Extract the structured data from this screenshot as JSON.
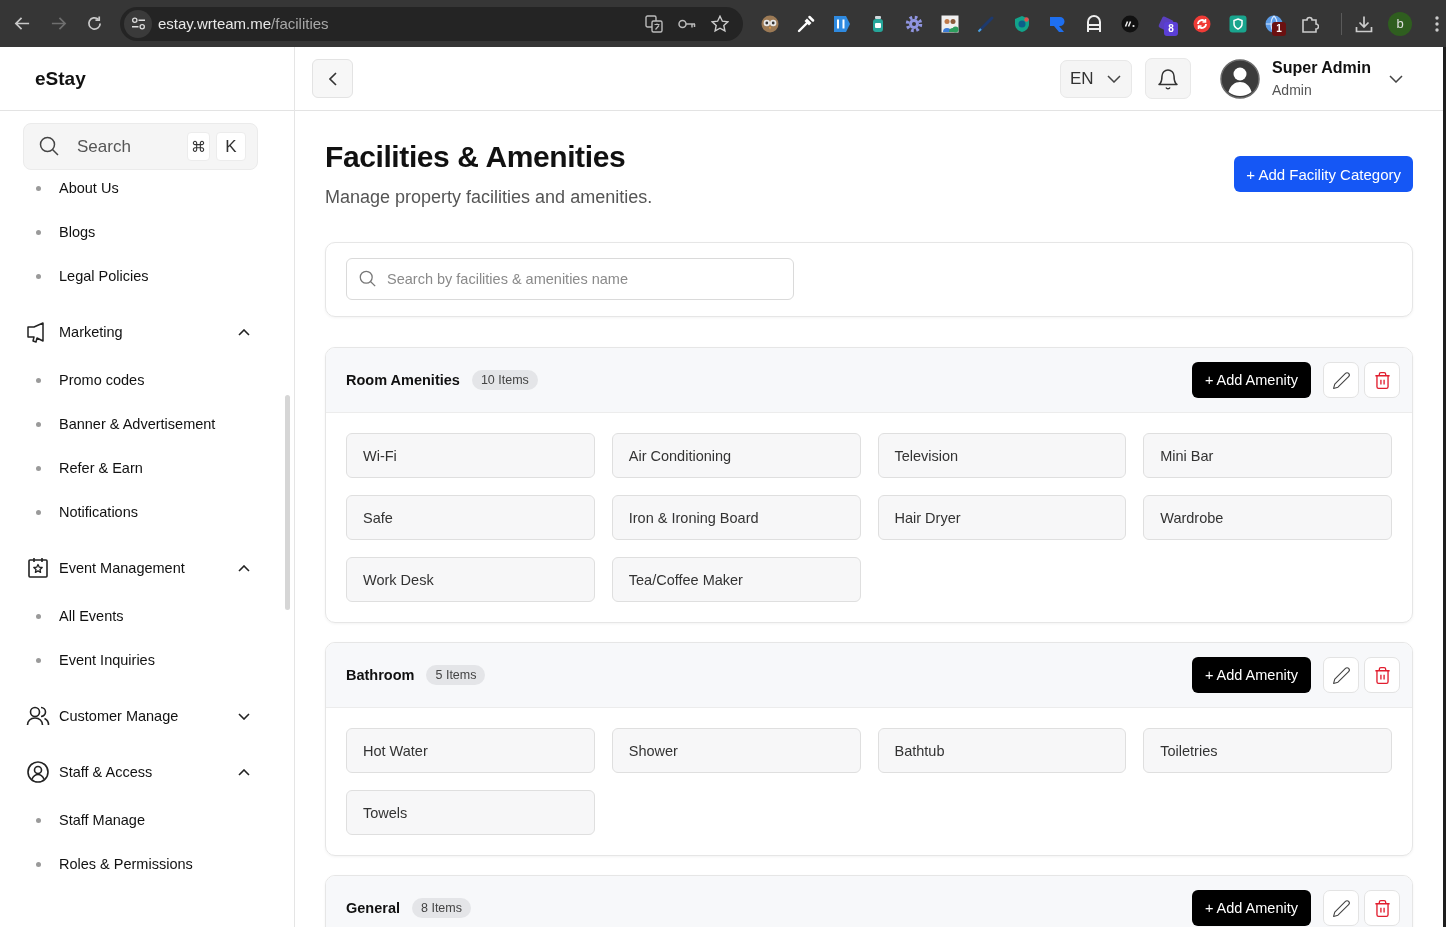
{
  "browser": {
    "url_host": "estay.wrteam.me",
    "url_path": "/facilities",
    "forward": {
      "disabled": true
    },
    "extension_badges": [
      {
        "text": "8",
        "color": "#5b3fd6"
      },
      {
        "text": "1",
        "color": "#6b1111"
      }
    ],
    "profile_initial": "b"
  },
  "sidebar": {
    "brand": "eStay",
    "search": {
      "placeholder": "Search",
      "keys": [
        "⌘",
        "K"
      ]
    },
    "nav": [
      {
        "kind": "link",
        "label": "About Us"
      },
      {
        "kind": "link",
        "label": "Blogs"
      },
      {
        "kind": "link",
        "label": "Legal Policies"
      },
      {
        "kind": "group",
        "label": "Marketing",
        "expanded": true,
        "children": [
          {
            "label": "Promo codes"
          },
          {
            "label": "Banner & Advertisement"
          },
          {
            "label": "Refer & Earn"
          },
          {
            "label": "Notifications"
          }
        ]
      },
      {
        "kind": "group",
        "label": "Event Management",
        "expanded": true,
        "children": [
          {
            "label": "All Events"
          },
          {
            "label": "Event Inquiries"
          }
        ]
      },
      {
        "kind": "group",
        "label": "Customer Manage",
        "expanded": false
      },
      {
        "kind": "group",
        "label": "Staff & Access",
        "expanded": true,
        "children": [
          {
            "label": "Staff Manage"
          },
          {
            "label": "Roles & Permissions"
          }
        ]
      }
    ]
  },
  "header": {
    "language": "EN",
    "user": {
      "name": "Super Admin",
      "role": "Admin"
    }
  },
  "page": {
    "title": "Facilities & Amenities",
    "subtitle": "Manage property facilities and amenities.",
    "add_button": "+ Add Facility Category",
    "search": {
      "placeholder": "Search by facilities & amenities name"
    }
  },
  "categories": [
    {
      "name": "Room Amenities",
      "count": "10 Items",
      "add_button": "+ Add Amenity",
      "amenities": [
        "Wi-Fi",
        "Air Conditioning",
        "Television",
        "Mini Bar",
        "Safe",
        "Iron & Ironing Board",
        "Hair Dryer",
        "Wardrobe",
        "Work Desk",
        "Tea/Coffee Maker"
      ]
    },
    {
      "name": "Bathroom",
      "count": "5 Items",
      "add_button": "+ Add Amenity",
      "amenities": [
        "Hot Water",
        "Shower",
        "Bathtub",
        "Toiletries",
        "Towels"
      ]
    },
    {
      "name": "General",
      "count": "8 Items",
      "add_button": "+ Add Amenity"
    }
  ]
}
